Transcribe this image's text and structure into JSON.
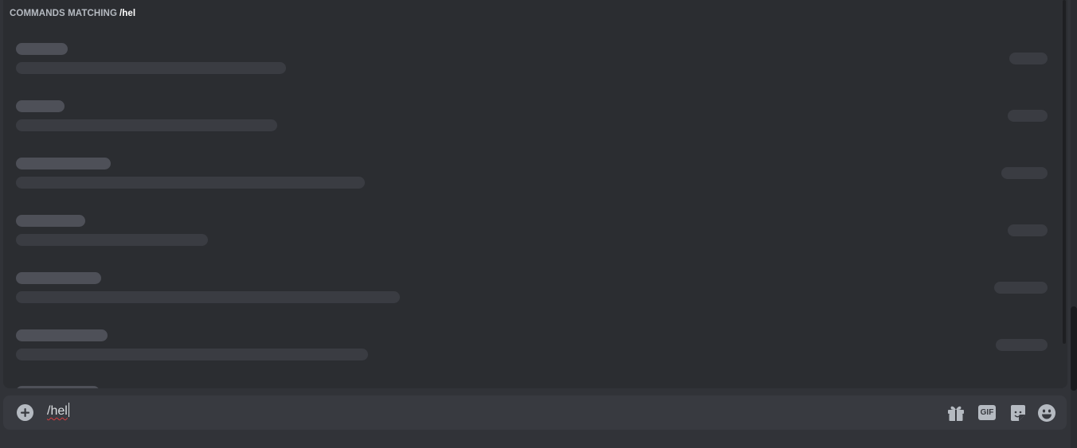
{
  "autocomplete": {
    "header_label": "COMMANDS MATCHING",
    "header_query": "/hel",
    "skeleton_rows_loading": 7
  },
  "composer": {
    "input_value": "/hel",
    "attach_icon": "plus-circle-icon",
    "gift_icon": "gift-icon",
    "gif_label": "GIF",
    "sticker_icon": "sticker-icon",
    "emoji_icon": "smiley-emoji-icon"
  },
  "colors": {
    "background": "#313338",
    "popup": "#2b2d31",
    "composer": "#383a40",
    "skeleton_strong": "#4e5058",
    "skeleton_weak": "#3a3c42",
    "icon": "#b5bac1",
    "spellcheck": "#d83c3e"
  }
}
